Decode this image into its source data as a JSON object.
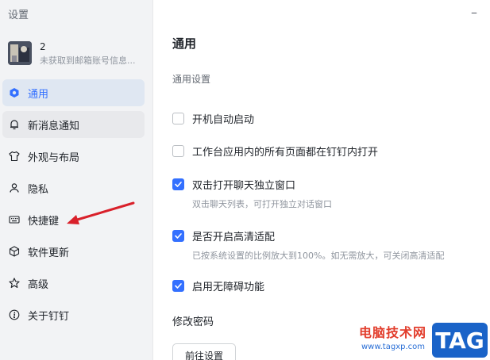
{
  "sidebar": {
    "title": "设置",
    "profile": {
      "name": "2",
      "subtitle": "未获取到邮箱账号信息..."
    },
    "items": [
      {
        "label": "通用",
        "icon": "general-icon",
        "active": true
      },
      {
        "label": "新消息通知",
        "icon": "bell-icon"
      },
      {
        "label": "外观与布局",
        "icon": "tshirt-icon"
      },
      {
        "label": "隐私",
        "icon": "user-icon"
      },
      {
        "label": "快捷键",
        "icon": "keyboard-icon"
      },
      {
        "label": "软件更新",
        "icon": "cube-icon"
      },
      {
        "label": "高级",
        "icon": "star-icon"
      },
      {
        "label": "关于钉钉",
        "icon": "info-icon"
      }
    ]
  },
  "main": {
    "minimize": "–",
    "title": "通用",
    "section": "通用设置",
    "options": [
      {
        "label": "开机自动启动",
        "checked": false
      },
      {
        "label": "工作台应用内的所有页面都在钉钉内打开",
        "checked": false
      },
      {
        "label": "双击打开聊天独立窗口",
        "checked": true,
        "description": "双击聊天列表，可打开独立对话窗口"
      },
      {
        "label": "是否开启高清适配",
        "checked": true,
        "description": "已按系统设置的比例放大到100%。如无需放大，可关闭高清适配"
      },
      {
        "label": "启用无障碍功能",
        "checked": true
      }
    ],
    "password_label": "修改密码",
    "password_button": "前往设置"
  },
  "watermark": {
    "site_name": "电脑技术网",
    "url": "www.tagxp.com",
    "tag": "TAG"
  },
  "colors": {
    "accent": "#3370ff",
    "arrow": "#d9202a"
  }
}
